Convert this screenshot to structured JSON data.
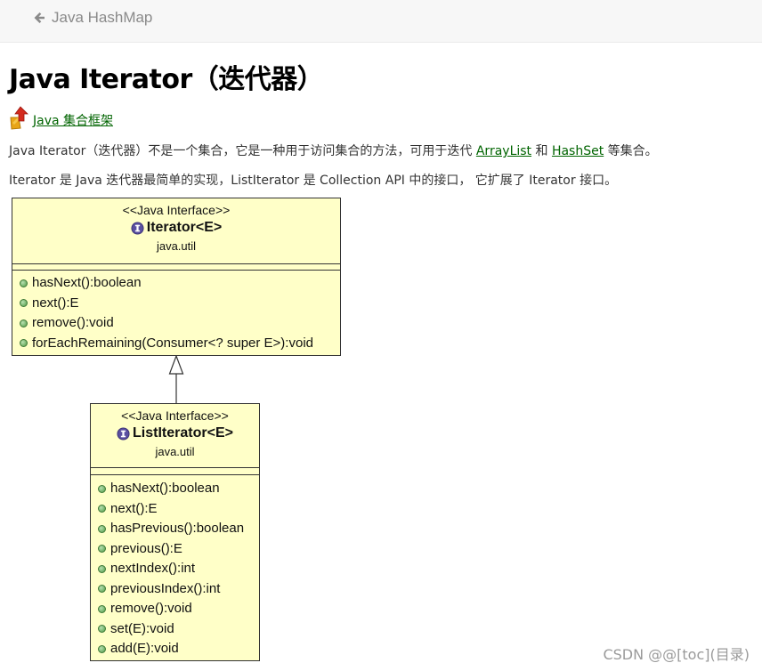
{
  "nav": {
    "back_label": "Java HashMap",
    "back_icon": "arrow-left-icon"
  },
  "title": "Java Iterator（迭代器）",
  "breadcrumb": {
    "icon": "up-arrow-icon",
    "label": "Java 集合框架"
  },
  "para1": {
    "before": "Java Iterator（迭代器）不是一个集合，它是一种用于访问集合的方法，可用于迭代 ",
    "link1": "ArrayList",
    "middle": " 和 ",
    "link2": "HashSet",
    "after": " 等集合。"
  },
  "para2": "Iterator 是 Java 迭代器最简单的实现，ListIterator 是 Collection API 中的接口， 它扩展了 Iterator 接口。",
  "diagram": {
    "iterator": {
      "stereotype": "<<Java Interface>>",
      "name": "Iterator<E>",
      "package": "java.util",
      "methods": [
        "hasNext():boolean",
        "next():E",
        "remove():void",
        "forEachRemaining(Consumer<? super E>):void"
      ]
    },
    "list_iterator": {
      "stereotype": "<<Java Interface>>",
      "name": "ListIterator<E>",
      "package": "java.util",
      "methods": [
        "hasNext():boolean",
        "next():E",
        "hasPrevious():boolean",
        "previous():E",
        "nextIndex():int",
        "previousIndex():int",
        "remove():void",
        "set(E):void",
        "add(E):void"
      ]
    }
  },
  "colors": {
    "link": "#006400",
    "uml_fill": "#ffffc8",
    "method_dot": "#4f9a45",
    "interface_icon": "#5a4fa0"
  },
  "watermark": "CSDN @@[toc](目录)"
}
